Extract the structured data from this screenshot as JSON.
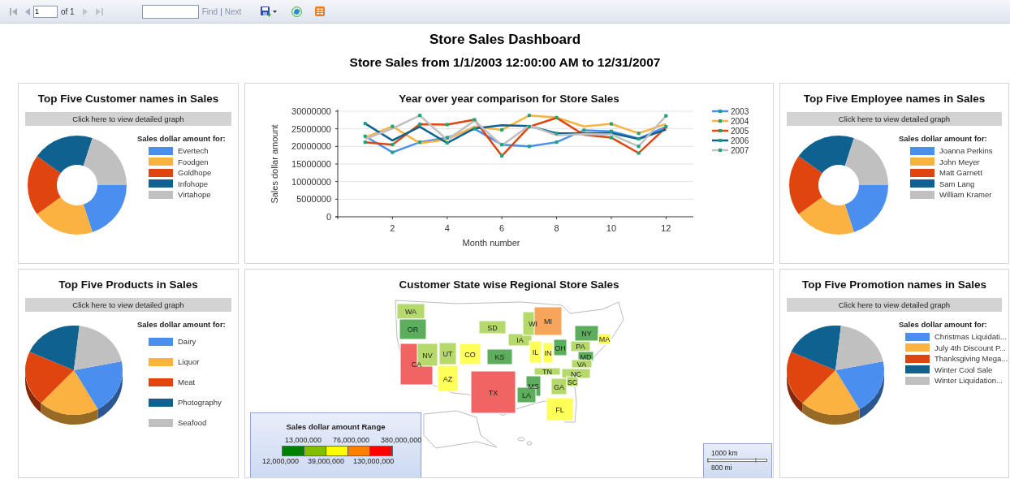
{
  "toolbar": {
    "page": "1",
    "page_count": "of 1",
    "find_link": "Find",
    "separator": "|",
    "next_link": "Next"
  },
  "title": "Store Sales Dashboard",
  "subtitle": "Store Sales from 1/1/2003 12:00:00 AM to 12/31/2007",
  "panels": [
    {
      "kind": "donut",
      "title": "Top Five Customer names in Sales",
      "button": "Click here to view detailed graph",
      "legend_title": "Sales dollar amount for:",
      "legend": [
        {
          "label": "Evertech",
          "color": "#4a8ff0"
        },
        {
          "label": "Foodgen",
          "color": "#fbb240"
        },
        {
          "label": "Goldhope",
          "color": "#e04510"
        },
        {
          "label": "Infohope",
          "color": "#0f6290"
        },
        {
          "label": "Virtahope",
          "color": "#c0c0c0"
        }
      ]
    },
    {
      "kind": "line",
      "chart_data": {
        "type": "line",
        "grid": true,
        "legend": "right",
        "title": "Year over year comparison for Store Sales",
        "xlabel": "Month number",
        "ylabel": "Sales dollar amount",
        "x": [
          1,
          2,
          3,
          4,
          5,
          6,
          7,
          8,
          9,
          10,
          11,
          12
        ],
        "xlim": [
          0,
          13
        ],
        "ylim": [
          0,
          30000000
        ],
        "xticks": [
          2,
          4,
          6,
          8,
          10,
          12
        ],
        "yticks": [
          0,
          5000000,
          10000000,
          15000000,
          20000000,
          25000000,
          30000000
        ],
        "series": [
          {
            "name": "2003",
            "color": "#4a8ff0",
            "marker": true,
            "values": [
              22900000,
              18300000,
              21200000,
              22500000,
              25000000,
              20500000,
              20000000,
              21200000,
              24600000,
              24300000,
              22200000,
              25600000
            ]
          },
          {
            "name": "2004",
            "color": "#fbb240",
            "marker": true,
            "values": [
              22500000,
              25700000,
              20900000,
              22000000,
              25600000,
              24700000,
              28800000,
              28200000,
              25700000,
              26400000,
              23700000,
              26400000
            ]
          },
          {
            "name": "2005",
            "color": "#e04510",
            "marker": true,
            "values": [
              21200000,
              20500000,
              26300000,
              26200000,
              27600000,
              17300000,
              25600000,
              28100000,
              23300000,
              22500000,
              18100000,
              25400000
            ]
          },
          {
            "name": "2006",
            "color": "#0f6290",
            "marker": true,
            "values": [
              26500000,
              21700000,
              25600000,
              21000000,
              25100000,
              26000000,
              25800000,
              23700000,
              23700000,
              23800000,
              22100000,
              24800000
            ]
          },
          {
            "name": "2007",
            "color": "#c0c0c0",
            "marker": true,
            "values": [
              22100000,
              25100000,
              28800000,
              21900000,
              27300000,
              20300000,
              25900000,
              23200000,
              23500000,
              23400000,
              20000000,
              28700000
            ]
          }
        ]
      }
    },
    {
      "kind": "donut",
      "title": "Top Five Employee names in Sales",
      "button": "Click here to view detailed graph",
      "legend_title": "Sales dollar amount for:",
      "legend": [
        {
          "label": "Joanna Perkins",
          "color": "#4a8ff0"
        },
        {
          "label": "John Meyer",
          "color": "#fbb240"
        },
        {
          "label": "Matt Garnett",
          "color": "#e04510"
        },
        {
          "label": "Sam Lang",
          "color": "#0f6290"
        },
        {
          "label": "William Kramer",
          "color": "#c0c0c0"
        }
      ]
    },
    {
      "kind": "pie3d",
      "title": "Top Five Products in Sales",
      "button": "Click here to view detailed graph",
      "legend_title": "Sales dollar amount for:",
      "legend": [
        {
          "label": "Dairy",
          "color": "#4a8ff0"
        },
        {
          "label": "Liquor",
          "color": "#fbb240"
        },
        {
          "label": "Meat",
          "color": "#e04510"
        },
        {
          "label": "Photography",
          "color": "#0f6290"
        },
        {
          "label": "Seafood",
          "color": "#c0c0c0"
        }
      ]
    },
    {
      "kind": "map",
      "title": "Customer State wise Regional Store Sales",
      "states": [
        {
          "label": "WA",
          "color": "#b5d96a"
        },
        {
          "label": "OR",
          "color": "#5cad5c"
        },
        {
          "label": "CA",
          "color": "#f06464"
        },
        {
          "label": "NV",
          "color": "#b5d96a"
        },
        {
          "label": "UT",
          "color": "#b5d96a"
        },
        {
          "label": "CO",
          "color": "#ffff5a"
        },
        {
          "label": "AZ",
          "color": "#ffff5a"
        },
        {
          "label": "SD",
          "color": "#b5d96a"
        },
        {
          "label": "KS",
          "color": "#5cad5c"
        },
        {
          "label": "TX",
          "color": "#f06464"
        },
        {
          "label": "IA",
          "color": "#b5d96a"
        },
        {
          "label": "WI",
          "color": "#b5d96a"
        },
        {
          "label": "MI",
          "color": "#f7a55a"
        },
        {
          "label": "IL",
          "color": "#ffff5a"
        },
        {
          "label": "IN",
          "color": "#ffff5a"
        },
        {
          "label": "OH",
          "color": "#5cad5c"
        },
        {
          "label": "PA",
          "color": "#b5d96a"
        },
        {
          "label": "NY",
          "color": "#5cad5c"
        },
        {
          "label": "MA",
          "color": "#ffff5a"
        },
        {
          "label": "MD",
          "color": "#5cad5c"
        },
        {
          "label": "VA",
          "color": "#b5d96a"
        },
        {
          "label": "NC",
          "color": "#b5d96a"
        },
        {
          "label": "TN",
          "color": "#b5d96a"
        },
        {
          "label": "MS",
          "color": "#5cad5c"
        },
        {
          "label": "GA",
          "color": "#b5d96a"
        },
        {
          "label": "SC",
          "color": "#b5d96a"
        },
        {
          "label": "LA",
          "color": "#5cad5c"
        },
        {
          "label": "FL",
          "color": "#ffff5a"
        }
      ],
      "range_legend": {
        "title": "Sales dollar amount Range",
        "upper_labels": [
          "13,000,000",
          "76,000,000",
          "380,000,000"
        ],
        "lower_labels": [
          "12,000,000",
          "39,000,000",
          "130,000,000"
        ],
        "swatches": [
          {
            "color": "#008000"
          },
          {
            "color": "#80c000"
          },
          {
            "color": "#ffff00"
          },
          {
            "color": "#ff8000"
          },
          {
            "color": "#ff0000"
          }
        ]
      },
      "scale": {
        "km": "1000 km",
        "mi": "800 mi"
      }
    },
    {
      "kind": "pie3d",
      "title": "Top Five Promotion names in Sales",
      "button": "Click here to view detailed graph",
      "legend_title": "Sales dollar amount for:",
      "legend": [
        {
          "label": "Christmas Liquidati...",
          "color": "#4a8ff0"
        },
        {
          "label": "July 4th Discount P...",
          "color": "#fbb240"
        },
        {
          "label": "Thanksgiving  Mega...",
          "color": "#e04510"
        },
        {
          "label": "Winter Cool Sale",
          "color": "#0f6290"
        },
        {
          "label": "Winter  Liquidation...",
          "color": "#c0c0c0"
        }
      ]
    }
  ]
}
